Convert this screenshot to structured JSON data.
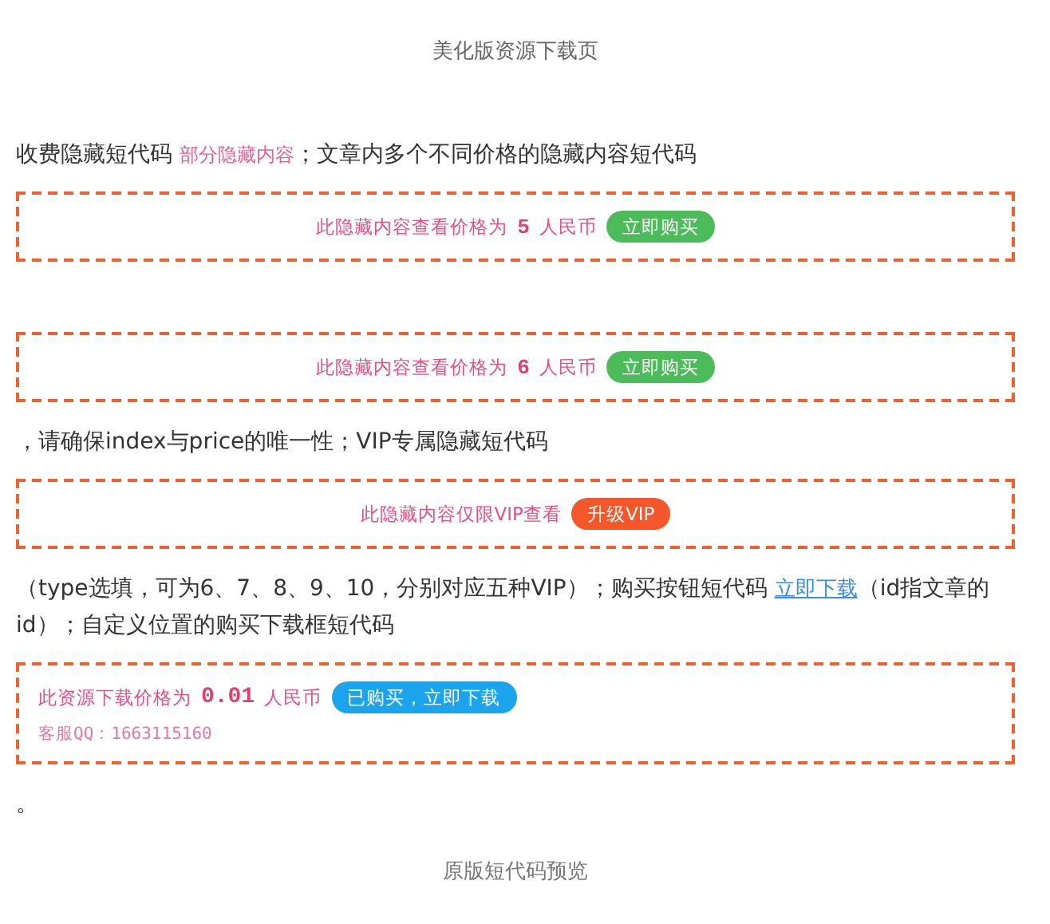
{
  "title": "美化版资源下载页",
  "blocks": [
    {
      "kind": "paragraph",
      "parts": [
        {
          "kind": "plain",
          "text": "收费隐藏短代码 "
        },
        {
          "kind": "pink",
          "text": "部分隐藏内容"
        },
        {
          "kind": "plain",
          "text": "；文章内多个不同价格的隐藏内容短代码"
        }
      ]
    },
    {
      "kind": "price",
      "text": "此隐藏内容查看价格为",
      "price": "5",
      "unit": "人民币",
      "button": "立即购买"
    },
    {
      "kind": "spacer"
    },
    {
      "kind": "price",
      "text": "此隐藏内容查看价格为",
      "price": "6",
      "unit": "人民币",
      "button": "立即购买"
    },
    {
      "kind": "paragraph",
      "parts": [
        {
          "kind": "plain",
          "text": "，请确保index与price的唯一性；VIP专属隐藏短代码"
        }
      ]
    },
    {
      "kind": "vip",
      "text": "此隐藏内容仅限VIP查看",
      "button": "升级VIP"
    },
    {
      "kind": "paragraph",
      "parts": [
        {
          "kind": "plain",
          "text": "（type选填，可为6、7、8、9、10，分别对应五种VIP）；购买按钮短代码 "
        },
        {
          "kind": "link",
          "text": "立即下载"
        },
        {
          "kind": "plain",
          "text": "（id指文章的id）；自定义位置的购买下载框短代码"
        }
      ]
    },
    {
      "kind": "download",
      "text": "此资源下载价格为",
      "price": "0.01",
      "unit": "人民币",
      "button": "已购买，立即下载",
      "contact": "客服QQ：1663115160"
    },
    {
      "kind": "paragraph",
      "parts": [
        {
          "kind": "plain",
          "text": "。"
        }
      ]
    }
  ],
  "footer": "原版短代码预览"
}
